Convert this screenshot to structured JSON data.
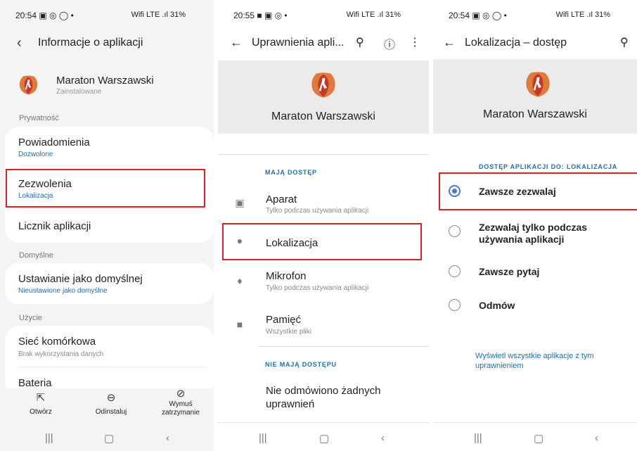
{
  "screen1": {
    "status": {
      "time": "20:54",
      "left_icons": "▣ ◎ ◯ •",
      "right": "Wifi LTE .ıl 31%"
    },
    "header": {
      "title": "Informacje o aplikacji"
    },
    "app": {
      "name": "Maraton Warszawski",
      "subtitle": "Zainstalowane"
    },
    "section_privacy": "Prywatność",
    "notifications": {
      "title": "Powiadomienia",
      "value": "Dozwolone"
    },
    "permissions": {
      "title": "Zezwolenia",
      "value": "Lokalizacja"
    },
    "app_counter": {
      "title": "Licznik aplikacji"
    },
    "section_defaults": "Domyślne",
    "set_default": {
      "title": "Ustawianie jako domyślnej",
      "value": "Nieustawione jako domyślne"
    },
    "section_usage": "Użycie",
    "mobile_data": {
      "title": "Sieć komórkowa",
      "value": "Brak wykorzystania danych"
    },
    "battery": {
      "title": "Bateria"
    },
    "actions": {
      "open": "Otwórz",
      "uninstall": "Odinstaluj",
      "force_stop_1": "Wymuś",
      "force_stop_2": "zatrzymanie"
    }
  },
  "screen2": {
    "status": {
      "time": "20:55",
      "left_icons": "■ ▣ ◎ •",
      "right": "Wifi LTE .ıl 31%"
    },
    "header": {
      "title": "Uprawnienia apli..."
    },
    "banner_name": "Maraton Warszawski",
    "allowed_caption": "MAJĄ DOSTĘP",
    "camera": {
      "title": "Aparat",
      "sub": "Tylko podczas używania aplikacji"
    },
    "location": {
      "title": "Lokalizacja"
    },
    "microphone": {
      "title": "Mikrofon",
      "sub": "Tylko podczas używania aplikacji"
    },
    "storage": {
      "title": "Pamięć",
      "sub": "Wszystkie pliki"
    },
    "denied_caption": "NIE MAJĄ DOSTĘPU",
    "none_denied_1": "Nie odmówiono żadnych",
    "none_denied_2": "uprawnień"
  },
  "screen3": {
    "status": {
      "time": "20:54",
      "left_icons": "▣ ◎ ◯ •",
      "right": "Wifi LTE .ıl 31%"
    },
    "header": {
      "title": "Lokalizacja – dostęp"
    },
    "banner_name": "Maraton Warszawski",
    "caption": "DOSTĘP APLIKACJI DO: LOKALIZACJA",
    "options": {
      "always": "Zawsze zezwalaj",
      "while_using_1": "Zezwalaj tylko podczas",
      "while_using_2": "używania aplikacji",
      "ask": "Zawsze pytaj",
      "deny": "Odmów"
    },
    "selected": "always",
    "link_1": "Wyświetl wszystkie aplikacje z tym",
    "link_2": "uprawnieniem"
  },
  "colors": {
    "accent_blue": "#1e6eb5",
    "highlight_red": "#e02020",
    "radio_blue": "#4a77d4"
  }
}
